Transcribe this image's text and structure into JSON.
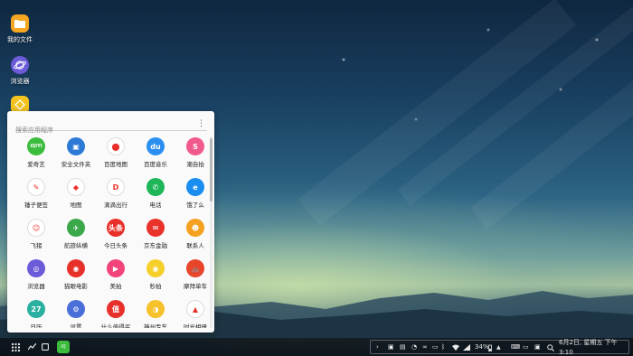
{
  "desktop": {
    "icons": [
      {
        "label": "我的文件",
        "icon": "folder-icon",
        "color": "#f5a623"
      },
      {
        "label": "浏览器",
        "icon": "planet-icon",
        "color": "#6b5bd8"
      },
      {
        "label": "",
        "icon": "bixby-icon",
        "color": "#f3c320"
      }
    ]
  },
  "drawer": {
    "search_placeholder": "搜索应用程序",
    "menu_glyph": "⋮",
    "scroll_position": 0.0,
    "apps": [
      {
        "label": "爱奇艺",
        "icon": "iqiyi-icon",
        "color": "#3cbc3c",
        "glyph": "iQIYI"
      },
      {
        "label": "安全文件夹",
        "icon": "secure-folder-icon",
        "color": "#2d7ad6",
        "glyph": "▣"
      },
      {
        "label": "百度地图",
        "icon": "baidu-map-icon",
        "color": "#ffffff",
        "glyph": "⬤"
      },
      {
        "label": "百度音乐",
        "icon": "baidu-music-icon",
        "color": "#2b8ff0",
        "glyph": "du"
      },
      {
        "label": "潮自拍",
        "icon": "selfie-icon",
        "color": "#f05a8c",
        "glyph": "S"
      },
      {
        "label": "锤子便签",
        "icon": "notes-icon",
        "color": "#ffffff",
        "glyph": "✎"
      },
      {
        "label": "地图",
        "icon": "maps-icon",
        "color": "#ffffff",
        "glyph": "◆"
      },
      {
        "label": "滴滴出行",
        "icon": "didi-icon",
        "color": "#ffffff",
        "glyph": "D"
      },
      {
        "label": "电话",
        "icon": "phone-icon",
        "color": "#1fb65a",
        "glyph": "✆"
      },
      {
        "label": "饿了么",
        "icon": "eleme-icon",
        "color": "#1a8ef0",
        "glyph": "e"
      },
      {
        "label": "飞猪",
        "icon": "fliggy-icon",
        "color": "#ffffff",
        "glyph": "☺"
      },
      {
        "label": "航旅纵横",
        "icon": "umetrip-icon",
        "color": "#3aa84a",
        "glyph": "✈"
      },
      {
        "label": "今日头条",
        "icon": "toutiao-icon",
        "color": "#e8302a",
        "glyph": "头条"
      },
      {
        "label": "京东金融",
        "icon": "jd-finance-icon",
        "color": "#e8322a",
        "glyph": "✉"
      },
      {
        "label": "联系人",
        "icon": "contacts-icon",
        "color": "#f5a01f",
        "glyph": "☻"
      },
      {
        "label": "浏览器",
        "icon": "browser-icon",
        "color": "#6b5bd8",
        "glyph": "◎"
      },
      {
        "label": "猫眼电影",
        "icon": "maoyan-icon",
        "color": "#e8302a",
        "glyph": "◉"
      },
      {
        "label": "美拍",
        "icon": "meipai-icon",
        "color": "#f2447a",
        "glyph": "▶"
      },
      {
        "label": "秒拍",
        "icon": "miaopai-icon",
        "color": "#f6d02a",
        "glyph": "◉"
      },
      {
        "label": "摩拜单车",
        "icon": "mobike-icon",
        "color": "#e8452a",
        "glyph": "🚲"
      },
      {
        "label": "日历",
        "icon": "calendar-icon",
        "color": "#2ab0a0",
        "glyph": "27"
      },
      {
        "label": "设置",
        "icon": "settings-icon",
        "color": "#4a6fd8",
        "glyph": "⚙"
      },
      {
        "label": "什么值得买",
        "icon": "smzdm-icon",
        "color": "#e8302a",
        "glyph": "值"
      },
      {
        "label": "神州专车",
        "icon": "ucar-icon",
        "color": "#f6c12a",
        "glyph": "◑"
      },
      {
        "label": "时光相册",
        "icon": "photo-album-icon",
        "color": "#ffffff",
        "glyph": "▲"
      }
    ]
  },
  "taskbar": {
    "apps_icon": "apps-grid-icon",
    "battery_percent": "34%",
    "datetime": "6月2日, 星期五 下午 3:10"
  }
}
